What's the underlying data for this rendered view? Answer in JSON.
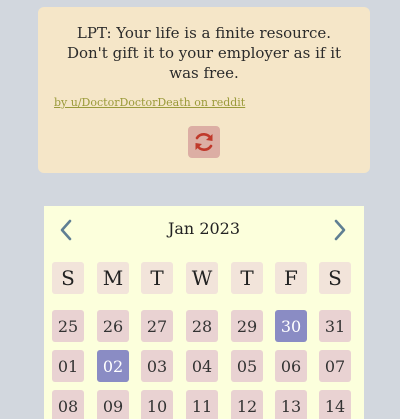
{
  "quote": {
    "text_lines": [
      "LPT: Your life is a finite resource.",
      "Don't gift it to your employer as if it",
      "was free."
    ],
    "source": "by u/DoctorDoctorDeath on reddit",
    "refresh_icon": "refresh-icon"
  },
  "calendar": {
    "month_label": "Jan 2023",
    "prev_icon": "chevron-left-icon",
    "next_icon": "chevron-right-icon",
    "weekdays": [
      "S",
      "M",
      "T",
      "W",
      "T",
      "F",
      "S"
    ],
    "weeks": [
      [
        "25",
        "26",
        "27",
        "28",
        "29",
        "30",
        "31"
      ],
      [
        "01",
        "02",
        "03",
        "04",
        "05",
        "06",
        "07"
      ],
      [
        "08",
        "09",
        "10",
        "11",
        "12",
        "13",
        "14"
      ]
    ],
    "selected_days": [
      "30",
      "02"
    ]
  },
  "colors": {
    "background": "#d2d7de",
    "quote_card": "#f5e6c8",
    "calendar_bg": "#fcffdc",
    "day_cell": "#e9d2d2",
    "weekday_cell": "#f2e4da",
    "selected_cell": "#8a8cc4",
    "refresh_button": "#dcaea4",
    "refresh_icon": "#c0392b",
    "link": "#9a9a3a",
    "nav_arrow": "#5f7f93"
  }
}
